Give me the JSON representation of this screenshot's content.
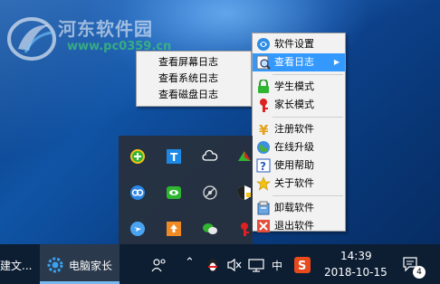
{
  "watermark": {
    "site_name": "河东软件园",
    "url": "www.pc0359.cn"
  },
  "submenu": {
    "items": [
      {
        "label": "查看屏幕日志"
      },
      {
        "label": "查看系统日志"
      },
      {
        "label": "查看磁盘日志"
      }
    ]
  },
  "main_menu": {
    "items": [
      {
        "label": "软件设置",
        "icon": "settings-icon"
      },
      {
        "label": "查看日志",
        "icon": "search-log-icon",
        "highlighted": true,
        "has_submenu": true
      },
      {
        "label": "学生模式",
        "icon": "green-lock-icon"
      },
      {
        "label": "家长模式",
        "icon": "red-key-icon"
      },
      {
        "label": "注册软件",
        "icon": "dollar-icon"
      },
      {
        "label": "在线升级",
        "icon": "globe-icon"
      },
      {
        "label": "使用帮助",
        "icon": "help-icon"
      },
      {
        "label": "关于软件",
        "icon": "star-icon"
      },
      {
        "label": "卸载软件",
        "icon": "uninstall-icon"
      },
      {
        "label": "退出软件",
        "icon": "exit-icon"
      }
    ],
    "submenu_arrow": "▶"
  },
  "tray_popup": {
    "icons": [
      "green-plus-icon",
      "blue-t-icon",
      "cloud-icon",
      "colorful-icon",
      "baidu-cloud-icon",
      "green-eye-icon",
      "satellite-icon",
      "shield-icon",
      "blue-bird-icon",
      "orange-upload-icon",
      "wechat-icon",
      "red-key-icon"
    ]
  },
  "taskbar": {
    "left_app_partial_label": "建文...",
    "active_app_label": "电脑家长",
    "ime_label": "中",
    "time": "14:39",
    "date": "2018-10-15",
    "notification_count": "4"
  },
  "colors": {
    "menu_highlight": "#3399ff",
    "taskbar_bg": "#0d1e33"
  }
}
